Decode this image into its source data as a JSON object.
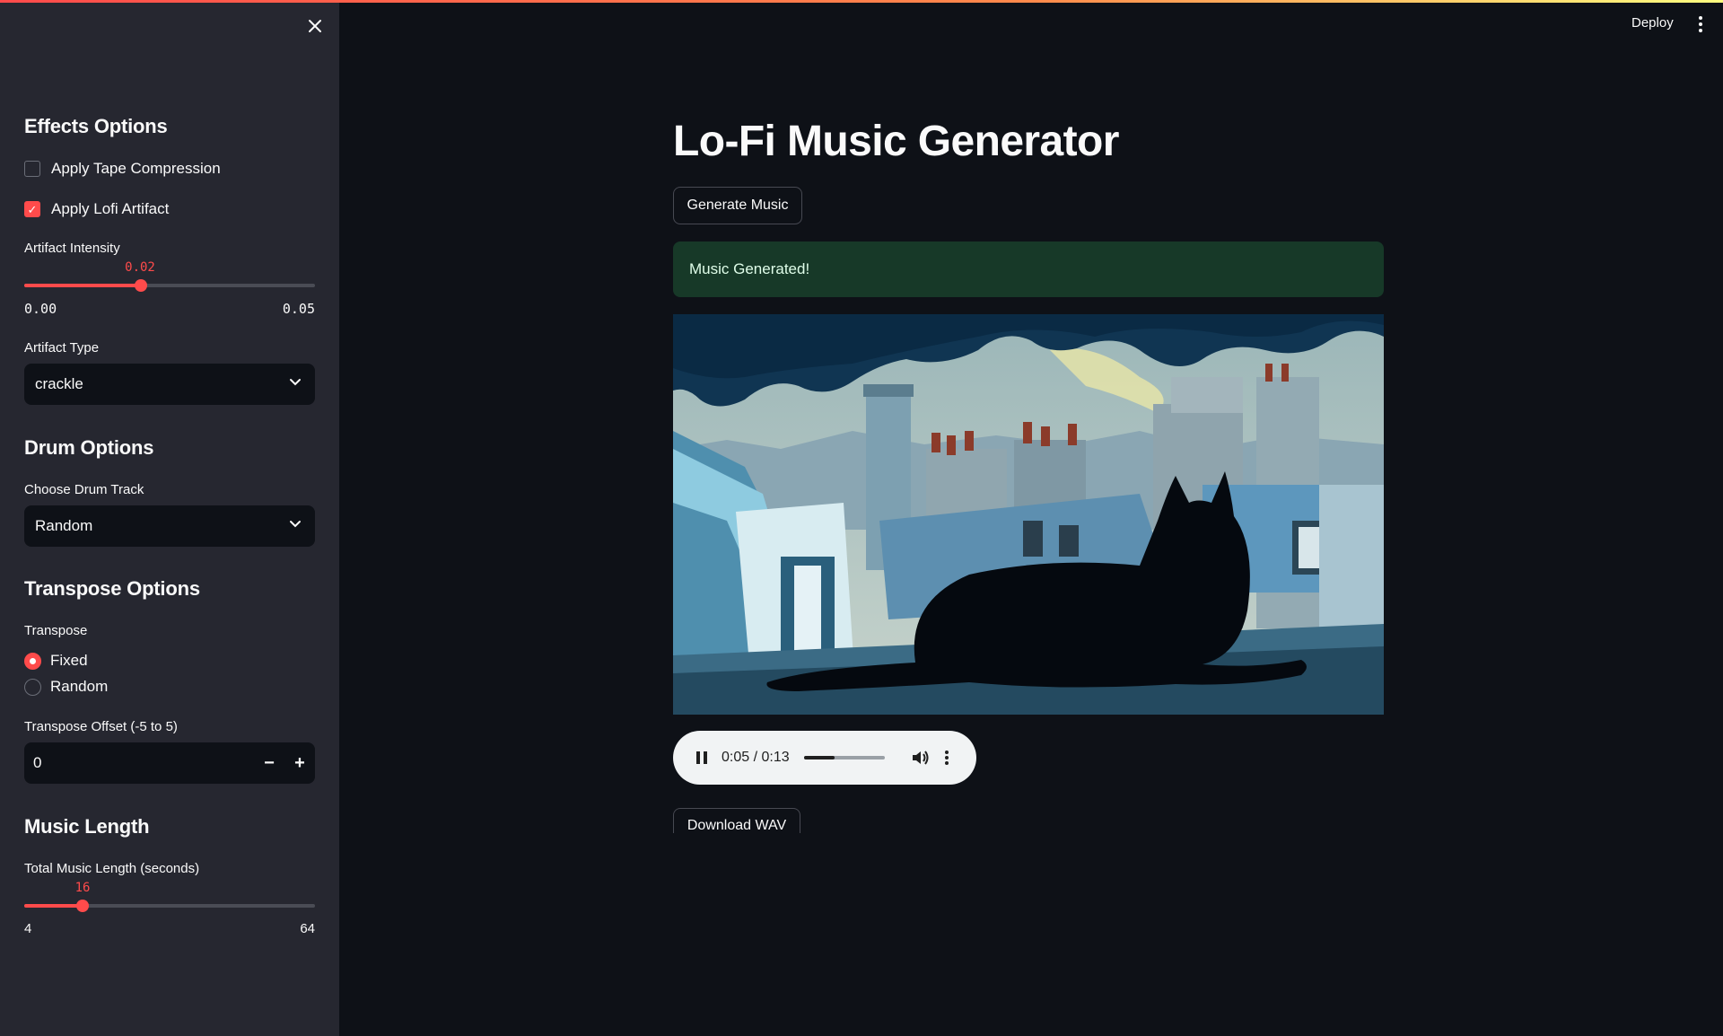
{
  "header": {
    "deploy_label": "Deploy",
    "menu_icon": "kebab-menu-icon"
  },
  "sidebar": {
    "close_icon": "close-icon",
    "effects": {
      "heading": "Effects Options",
      "tape_compression": {
        "label": "Apply Tape Compression",
        "checked": false
      },
      "lofi_artifact": {
        "label": "Apply Lofi Artifact",
        "checked": true
      },
      "artifact_intensity": {
        "label": "Artifact Intensity",
        "value": "0.02",
        "min": "0.00",
        "max": "0.05",
        "fraction": 0.4
      },
      "artifact_type": {
        "label": "Artifact Type",
        "selected": "crackle"
      }
    },
    "drum": {
      "heading": "Drum Options",
      "track": {
        "label": "Choose Drum Track",
        "selected": "Random"
      }
    },
    "transpose": {
      "heading": "Transpose Options",
      "label": "Transpose",
      "options": [
        "Fixed",
        "Random"
      ],
      "selected": "Fixed",
      "offset": {
        "label": "Transpose Offset (-5 to 5)",
        "value": "0",
        "minus": "−",
        "plus": "+"
      }
    },
    "music_length": {
      "heading": "Music Length",
      "total": {
        "label": "Total Music Length (seconds)",
        "value": "16",
        "min": "4",
        "max": "64",
        "fraction": 0.2
      }
    }
  },
  "main": {
    "title": "Lo-Fi Music Generator",
    "generate_button": "Generate Music",
    "success_message": "Music Generated!",
    "image_alt": "Black cat silhouette looking over rainy rooftops and chimneys",
    "audio": {
      "time": "0:05 / 0:13",
      "progress": 0.38,
      "play_state_icon": "pause-icon",
      "volume_icon": "volume-icon",
      "more_icon": "kebab-menu-icon"
    },
    "download_button": "Download WAV"
  },
  "colors": {
    "accent": "#ff4b4b",
    "sidebar_bg": "#262730",
    "main_bg": "#0e1117",
    "success_bg": "#173928"
  }
}
